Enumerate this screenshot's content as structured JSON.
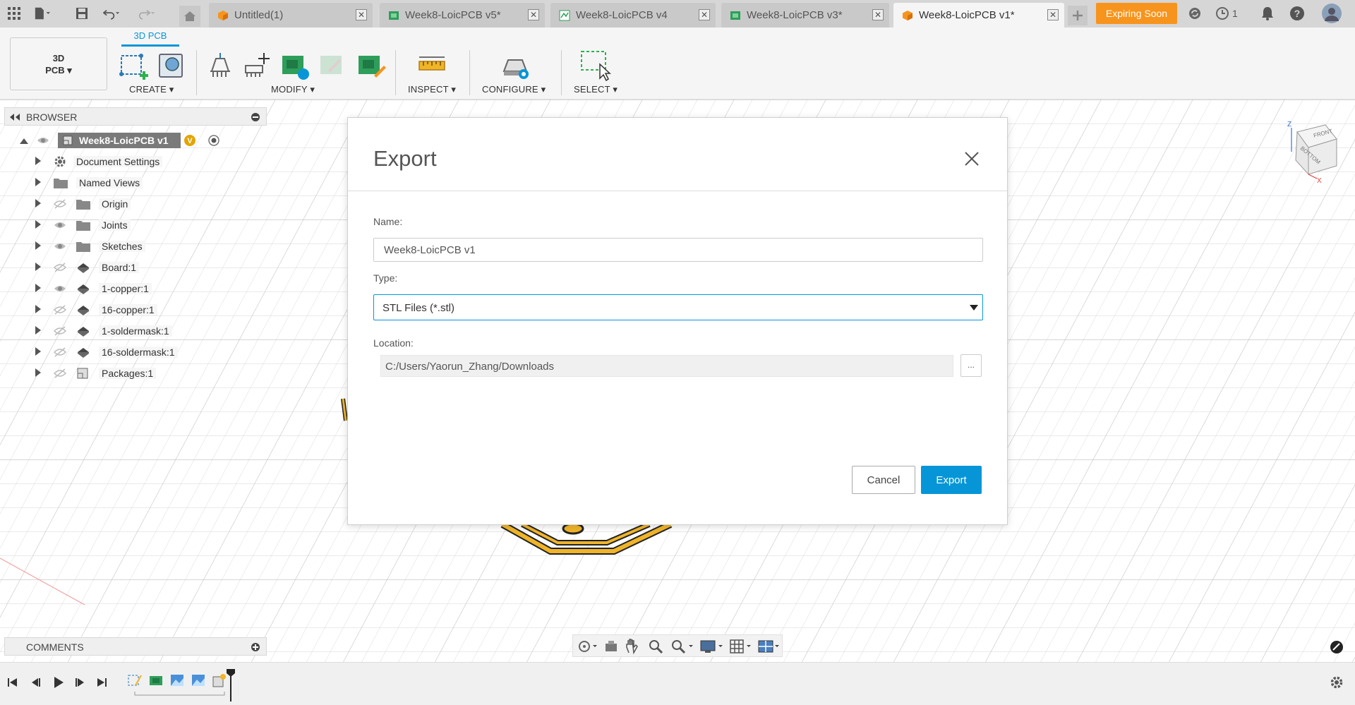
{
  "topbar": {
    "tabs": [
      {
        "label": "Untitled(1)",
        "icon": "component-orange-icon",
        "active": false
      },
      {
        "label": "Week8-LoicPCB v5*",
        "icon": "pcb-green-icon",
        "active": false
      },
      {
        "label": "Week8-LoicPCB v4",
        "icon": "schematic-green-icon",
        "active": false
      },
      {
        "label": "Week8-LoicPCB v3*",
        "icon": "pcb-green-icon",
        "active": false
      },
      {
        "label": "Week8-LoicPCB v1*",
        "icon": "component-orange-icon",
        "active": true
      }
    ],
    "expiring_label": "Expiring Soon",
    "job_count": "1",
    "accent": "#f7941d"
  },
  "ribbon": {
    "workspace_label_line1": "3D",
    "workspace_label_line2": "PCB",
    "active_tab": "3D PCB",
    "groups": {
      "create": "CREATE ▾",
      "modify": "MODIFY ▾",
      "inspect": "INSPECT ▾",
      "configure": "CONFIGURE ▾",
      "select": "SELECT ▾"
    }
  },
  "browser": {
    "title": "BROWSER",
    "root": "Week8-LoicPCB v1",
    "items": [
      {
        "label": "Document Settings",
        "icon": "gear-icon"
      },
      {
        "label": "Named Views",
        "icon": "folder-icon"
      },
      {
        "label": "Origin",
        "icon": "folder-icon",
        "visibility": "hidden"
      },
      {
        "label": "Joints",
        "icon": "folder-icon",
        "visibility": "visible"
      },
      {
        "label": "Sketches",
        "icon": "folder-icon",
        "visibility": "visible"
      },
      {
        "label": "Board:1",
        "icon": "body-icon",
        "visibility": "hidden"
      },
      {
        "label": "1-copper:1",
        "icon": "body-icon",
        "visibility": "visible"
      },
      {
        "label": "16-copper:1",
        "icon": "body-icon",
        "visibility": "hidden"
      },
      {
        "label": "1-soldermask:1",
        "icon": "body-icon",
        "visibility": "hidden"
      },
      {
        "label": "16-soldermask:1",
        "icon": "body-icon",
        "visibility": "hidden"
      },
      {
        "label": "Packages:1",
        "icon": "package-icon",
        "visibility": "hidden"
      }
    ]
  },
  "comments": {
    "title": "COMMENTS"
  },
  "dialog": {
    "title": "Export",
    "name_label": "Name:",
    "name_value": "Week8-LoicPCB v1",
    "type_label": "Type:",
    "type_value": "STL Files (*.stl)",
    "location_label": "Location:",
    "location_value": "C:/Users/Yaorun_Zhang/Downloads",
    "browse_label": "...",
    "cancel_label": "Cancel",
    "export_label": "Export",
    "accent": "#0696d7"
  },
  "viewcube": {
    "top_label": "FRONT",
    "side_label": "BOTTOM",
    "axis_z": "Z",
    "axis_x": "X"
  }
}
